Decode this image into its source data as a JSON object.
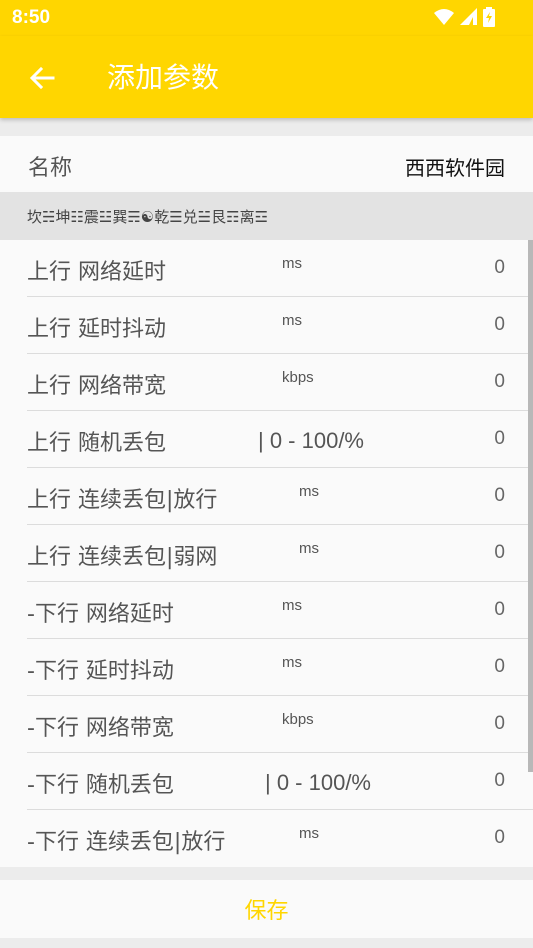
{
  "status": {
    "time": "8:50"
  },
  "appbar": {
    "title": "添加参数"
  },
  "name_row": {
    "label": "名称",
    "value": "西西软件园"
  },
  "section": {
    "header": "坎☵坤☷震☳巽☴☯乾☰兑☱艮☶离☲"
  },
  "rows": [
    {
      "label": "上行 网络延时",
      "unit": "ms",
      "value": "0"
    },
    {
      "label": "上行 延时抖动",
      "unit": "ms",
      "value": "0"
    },
    {
      "label": "上行 网络带宽",
      "unit": "kbps",
      "value": "0"
    },
    {
      "label": "上行 随机丢包",
      "unit": "| 0 - 100/%",
      "value": "0"
    },
    {
      "label": "上行 连续丢包|放行",
      "unit": "ms",
      "value": "0"
    },
    {
      "label": "上行 连续丢包|弱网",
      "unit": "ms",
      "value": "0"
    },
    {
      "label": "-下行 网络延时",
      "unit": "ms",
      "value": "0"
    },
    {
      "label": "-下行 延时抖动",
      "unit": "ms",
      "value": "0"
    },
    {
      "label": "-下行 网络带宽",
      "unit": "kbps",
      "value": "0"
    },
    {
      "label": "-下行 随机丢包",
      "unit": "| 0 - 100/%",
      "value": "0"
    },
    {
      "label": "-下行 连续丢包|放行",
      "unit": "ms",
      "value": "0"
    }
  ],
  "save": {
    "label": "保存"
  },
  "colors": {
    "accent": "#ffd600"
  }
}
